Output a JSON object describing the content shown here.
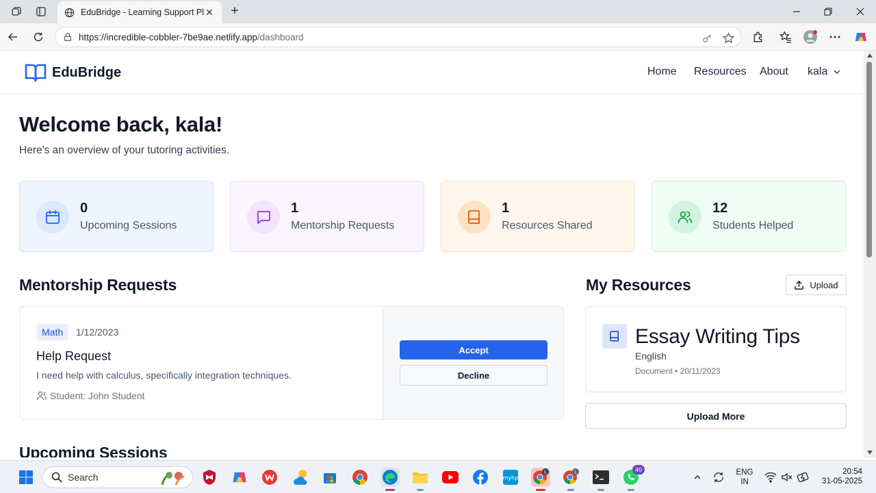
{
  "browser": {
    "tab_title": "EduBridge - Learning Support Pla",
    "url_host": "https://incredible-cobbler-7be9ae.netlify.app",
    "url_path": "/dashboard"
  },
  "site": {
    "brand": "EduBridge",
    "nav": [
      "Home",
      "Resources",
      "About"
    ],
    "user": "kala"
  },
  "welcome": {
    "title": "Welcome back, kala!",
    "subtitle": "Here's an overview of your tutoring activities."
  },
  "stats": [
    {
      "value": "0",
      "label": "Upcoming Sessions",
      "bg": "#eff5ff",
      "border": "#cfe0fb",
      "circle": "#dbe8fd",
      "icon_color": "#2563eb",
      "icon": "calendar-icon"
    },
    {
      "value": "1",
      "label": "Mentorship Requests",
      "bg": "#faf5ff",
      "border": "#eadcf8",
      "circle": "#f1e4fc",
      "icon_color": "#9333ea",
      "icon": "message-icon"
    },
    {
      "value": "1",
      "label": "Resources Shared",
      "bg": "#fff7ee",
      "border": "#f9e1c8",
      "circle": "#fde3c6",
      "icon_color": "#ea580c",
      "icon": "book-icon"
    },
    {
      "value": "12",
      "label": "Students Helped",
      "bg": "#f0fdf4",
      "border": "#cdeed9",
      "circle": "#d3f5df",
      "icon_color": "#16a34a",
      "icon": "users-icon"
    }
  ],
  "mentorship": {
    "heading": "Mentorship Requests",
    "request": {
      "subject": "Math",
      "date": "1/12/2023",
      "title": "Help Request",
      "description": "I need help with calculus, specifically integration techniques.",
      "student": "Student: John Student",
      "accept": "Accept",
      "decline": "Decline"
    }
  },
  "resources": {
    "heading": "My Resources",
    "upload": "Upload",
    "item": {
      "title": "Essay Writing Tips",
      "subject": "English",
      "meta": "Document • 20/11/2023"
    },
    "upload_more": "Upload More"
  },
  "sessions": {
    "heading": "Upcoming Sessions"
  },
  "taskbar": {
    "search": "Search",
    "whatsapp_badge": "40",
    "lang_top": "ENG",
    "lang_bottom": "IN",
    "time": "20:54",
    "date": "31-05-2025"
  },
  "colors": {
    "accent": "#2563eb"
  }
}
